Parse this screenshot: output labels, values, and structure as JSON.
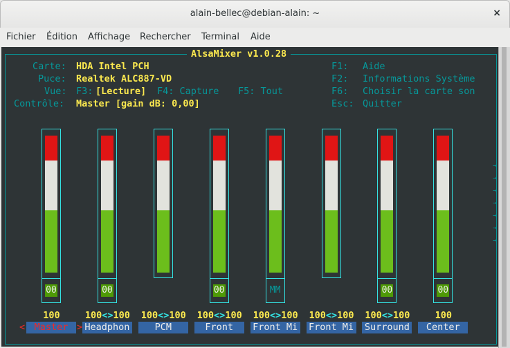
{
  "window": {
    "title": "alain-bellec@debian-alain: ~",
    "close": "×"
  },
  "menu": [
    "Fichier",
    "Édition",
    "Affichage",
    "Rechercher",
    "Terminal",
    "Aide"
  ],
  "app_title": "AlsaMixer v1.0.28",
  "info": {
    "carte_label": "Carte:",
    "carte": "HDA Intel PCH",
    "puce_label": "Puce:",
    "puce": "Realtek ALC887-VD",
    "vue_label": "Vue:",
    "f3": "F3:",
    "lecture": "[Lecture]",
    "f4": "F4: Capture",
    "f5": "F5: Tout",
    "controle_label": "Contrôle:",
    "controle": "Master [gain dB: 0,00]"
  },
  "keys": [
    {
      "k": "F1:",
      "v": "Aide"
    },
    {
      "k": "F2:",
      "v": "Informations Système"
    },
    {
      "k": "F6:",
      "v": "Choisir la carte son"
    },
    {
      "k": "Esc:",
      "v": "Quitter"
    }
  ],
  "colors": {
    "red": "#e01515",
    "white": "#e2e3dd",
    "green": "#6cbe1c",
    "cyan": "#34e2e2"
  },
  "channels": [
    {
      "name": "Master",
      "value": "100",
      "mute": "00",
      "level": 100,
      "selected": true
    },
    {
      "name": "Headphon",
      "value": "100<>100",
      "mute": "00",
      "level": 100
    },
    {
      "name": "PCM",
      "value": "100<>100",
      "mute": null,
      "level": 100
    },
    {
      "name": "Front",
      "value": "100<>100",
      "mute": "00",
      "level": 100
    },
    {
      "name": "Front Mi",
      "value": "100<>100",
      "mute": "MM",
      "level": 100
    },
    {
      "name": "Front Mi",
      "value": "100<>100",
      "mute": null,
      "level": 100
    },
    {
      "name": "Surround",
      "value": "100<>100",
      "mute": "00",
      "level": 100
    },
    {
      "name": "Center",
      "value": "100",
      "mute": "00",
      "level": 100
    }
  ],
  "sel_left": "<",
  "sel_right": ">",
  "more_arrow": "→"
}
